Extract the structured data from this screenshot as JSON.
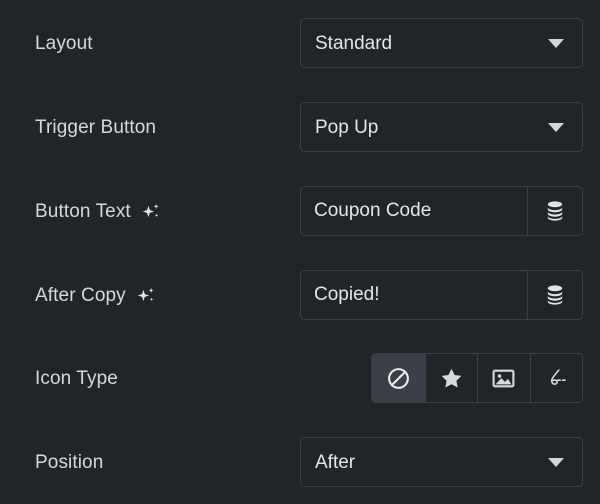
{
  "theme": {
    "background": "#212429",
    "border": "#3b3f45",
    "text": "#d6d9dc",
    "value_text": "#e4e6e8",
    "selected_background": "#3a4046",
    "icon": "#d6d9dc"
  },
  "rows": [
    {
      "id": "layout",
      "label": "Layout",
      "has_ai_icon": false,
      "control": "select",
      "value": "Standard",
      "options": [
        "Standard"
      ]
    },
    {
      "id": "trigger-button",
      "label": "Trigger Button",
      "has_ai_icon": false,
      "control": "select",
      "value": "Pop Up",
      "options": [
        "Pop Up"
      ]
    },
    {
      "id": "button-text",
      "label": "Button Text",
      "has_ai_icon": true,
      "ai_icon": "sparkle-icon",
      "control": "text",
      "value": "Coupon Code",
      "placeholder": "",
      "addon_icon": "database-icon"
    },
    {
      "id": "after-copy",
      "label": "After Copy",
      "has_ai_icon": true,
      "ai_icon": "sparkle-icon",
      "control": "text",
      "value": "Copied!",
      "placeholder": "",
      "addon_icon": "database-icon"
    },
    {
      "id": "icon-type",
      "label": "Icon Type",
      "has_ai_icon": false,
      "control": "icon-group",
      "selected_index": 0,
      "choices": [
        {
          "name": "none-icon",
          "label": "None"
        },
        {
          "name": "star-icon",
          "label": "Star"
        },
        {
          "name": "image-icon",
          "label": "Image"
        },
        {
          "name": "svg-path-icon",
          "label": "SVG"
        }
      ]
    },
    {
      "id": "position",
      "label": "Position",
      "has_ai_icon": false,
      "control": "select",
      "value": "After",
      "options": [
        "After"
      ]
    }
  ]
}
